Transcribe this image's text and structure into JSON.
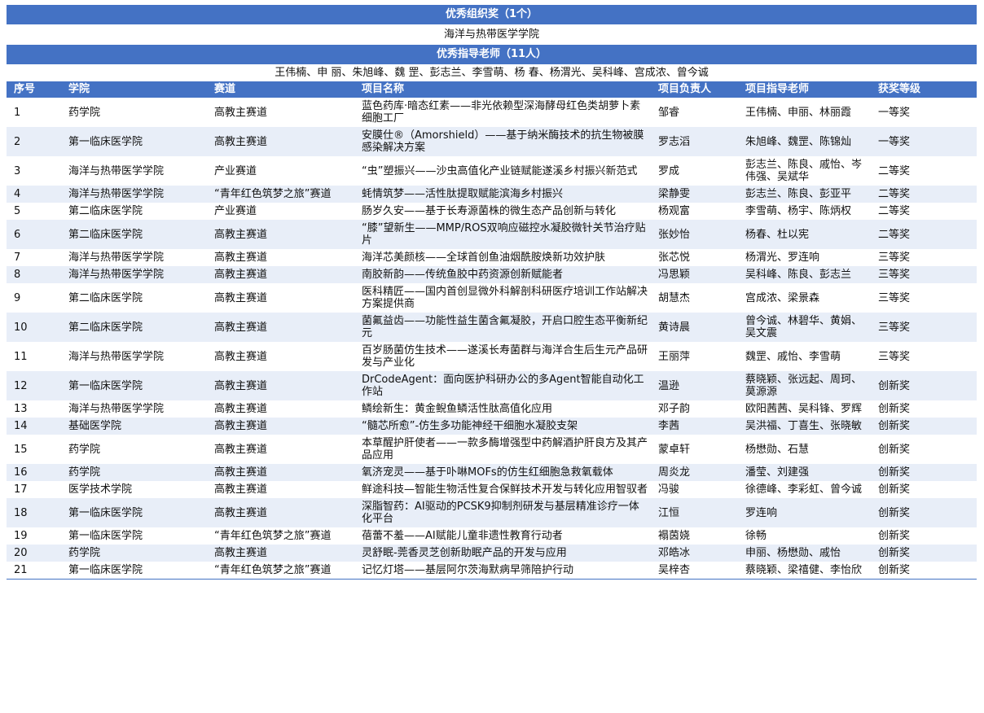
{
  "org_award": {
    "title": "优秀组织奖（1个）",
    "winner": "海洋与热带医学学院"
  },
  "teacher_award": {
    "title": "优秀指导老师（11人）",
    "winners": "王伟楠、申  丽、朱旭峰、魏  罡、彭志兰、李雪萌、杨  春、杨渭光、吴科峰、宫成浓、曾今诚"
  },
  "table": {
    "headers": [
      "序号",
      "学院",
      "赛道",
      "项目名称",
      "项目负责人",
      "项目指导老师",
      "获奖等级"
    ],
    "rows": [
      [
        "1",
        "药学院",
        "高教主赛道",
        "蓝色药库·暗态红素——非光依赖型深海酵母红色类胡萝卜素细胞工厂",
        "邹睿",
        "王伟楠、申丽、林丽霞",
        "一等奖"
      ],
      [
        "2",
        "第一临床医学院",
        "高教主赛道",
        "安膜仕®（Amorshield）——基于纳米酶技术的抗生物被膜感染解决方案",
        "罗志滔",
        "朱旭峰、魏罡、陈锦灿",
        "一等奖"
      ],
      [
        "3",
        "海洋与热带医学学院",
        "产业赛道",
        "“虫”塑振兴——沙虫高值化产业链赋能遂溪乡村振兴新范式",
        "罗成",
        "彭志兰、陈良、戚怡、岑伟强、吴斌华",
        "二等奖"
      ],
      [
        "4",
        "海洋与热带医学学院",
        "“青年红色筑梦之旅”赛道",
        "蚝情筑梦——活性肽提取赋能滨海乡村振兴",
        "梁静雯",
        "彭志兰、陈良、彭亚平",
        "二等奖"
      ],
      [
        "5",
        "第二临床医学院",
        "产业赛道",
        "肠岁久安——基于长寿源菌株的微生态产品创新与转化",
        "杨观富",
        "李雪萌、杨宇、陈炳权",
        "二等奖"
      ],
      [
        "6",
        "第二临床医学院",
        "高教主赛道",
        "“膝”望新生——MMP/ROS双响应磁控水凝胶微针关节治疗贴片",
        "张妙怡",
        "杨春、杜以宪",
        "二等奖"
      ],
      [
        "7",
        "海洋与热带医学学院",
        "高教主赛道",
        "海洋芯美颜核——全球首创鱼油烟酰胺焕新功效护肤",
        "张芯悦",
        "杨渭光、罗连响",
        "三等奖"
      ],
      [
        "8",
        "海洋与热带医学学院",
        "高教主赛道",
        "南胶新韵——传统鱼胶中药资源创新赋能者",
        "冯思颖",
        "吴科峰、陈良、彭志兰",
        "三等奖"
      ],
      [
        "9",
        "第二临床医学院",
        "高教主赛道",
        "医科精匠——国内首创显微外科解剖科研医疗培训工作站解决方案提供商",
        "胡慧杰",
        "宫成浓、梁景森",
        "三等奖"
      ],
      [
        "10",
        "第二临床医学院",
        "高教主赛道",
        "菌氟益齿——功能性益生菌含氟凝胶，开启口腔生态平衡新纪元",
        "黄诗晨",
        "曾今诚、林碧华、黄娟、吴文震",
        "三等奖"
      ],
      [
        "11",
        "海洋与热带医学学院",
        "高教主赛道",
        "百岁肠菌仿生技术——遂溪长寿菌群与海洋合生后生元产品研发与产业化",
        "王丽萍",
        "魏罡、戚怡、李雪萌",
        "三等奖"
      ],
      [
        "12",
        "第一临床医学院",
        "高教主赛道",
        "DrCodeAgent：面向医护科研办公的多Agent智能自动化工作站",
        "温逊",
        "蔡晓颖、张远起、周珂、莫源源",
        "创新奖"
      ],
      [
        "13",
        "海洋与热带医学学院",
        "高教主赛道",
        "鳞绘新生：黄金鲵鱼鳞活性肽高值化应用",
        "邓子韵",
        "欧阳茜茜、吴科锋、罗辉",
        "创新奖"
      ],
      [
        "14",
        "基础医学院",
        "高教主赛道",
        "“髓芯所愈”-仿生多功能神经干细胞水凝胶支架",
        "李茜",
        "吴洪福、丁喜生、张晓敏",
        "创新奖"
      ],
      [
        "15",
        "药学院",
        "高教主赛道",
        "本草醒护肝使者——一款多酶增强型中药解酒护肝良方及其产品应用",
        "蒙卓轩",
        "杨懋勋、石慧",
        "创新奖"
      ],
      [
        "16",
        "药学院",
        "高教主赛道",
        "氧济宠灵——基于卟啉MOFs的仿生红细胞急救氧载体",
        "周炎龙",
        "潘莹、刘建强",
        "创新奖"
      ],
      [
        "17",
        "医学技术学院",
        "高教主赛道",
        "鲜途科技—智能生物活性复合保鲜技术开发与转化应用智驭者",
        "冯骏",
        "徐德峰、李彩虹、曾今诚",
        "创新奖"
      ],
      [
        "18",
        "第一临床医学院",
        "高教主赛道",
        "深脂智药：AI驱动的PCSK9抑制剂研发与基层精准诊疗一体化平台",
        "江恒",
        "罗连响",
        "创新奖"
      ],
      [
        "19",
        "第一临床医学院",
        "“青年红色筑梦之旅”赛道",
        "蓓蕾不羞——AI赋能儿童非遗性教育行动者",
        "褟茵娆",
        "徐畅",
        "创新奖"
      ],
      [
        "20",
        "药学院",
        "高教主赛道",
        "灵舒眠-莞香灵芝创新助眠产品的开发与应用",
        "邓皓冰",
        "申丽、杨懋勋、戚怡",
        "创新奖"
      ],
      [
        "21",
        "第一临床医学院",
        "“青年红色筑梦之旅”赛道",
        "记忆灯塔——基层阿尔茨海默病早筛陪护行动",
        "吴梓杏",
        "蔡晓颖、梁禧健、李怡欣",
        "创新奖"
      ]
    ]
  }
}
